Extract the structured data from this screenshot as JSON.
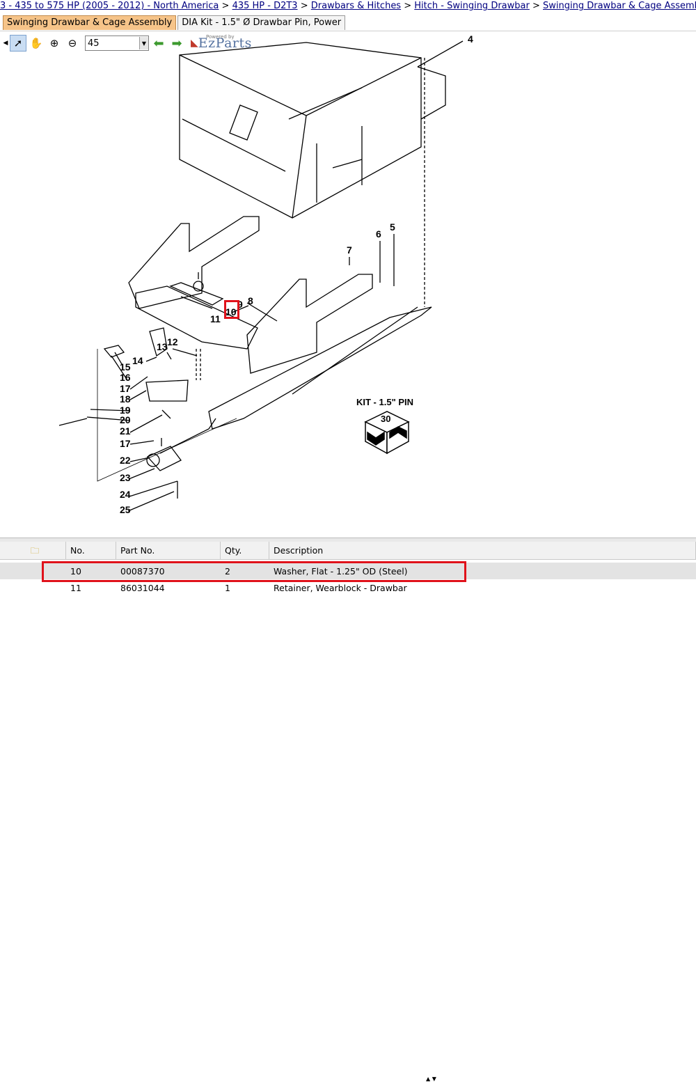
{
  "breadcrumb": [
    {
      "label": "3 - 435 to 575 HP (2005 - 2012) - North America"
    },
    {
      "label": "435 HP - D2T3"
    },
    {
      "label": "Drawbars & Hitches"
    },
    {
      "label": "Hitch - Swinging Drawbar"
    },
    {
      "label": "Swinging Drawbar & Cage Assembly"
    }
  ],
  "tabs": [
    {
      "label": "Swinging Drawbar & Cage Assembly"
    },
    {
      "label": "DIA Kit - 1.5\" Ø Drawbar Pin, Power"
    }
  ],
  "toolbar": {
    "zoom_value": "45",
    "brand_small": "Powered by",
    "brand_name": "EzParts"
  },
  "diagram": {
    "callouts": [
      "4",
      "5",
      "6",
      "7",
      "8",
      "9",
      "10",
      "11",
      "12",
      "13",
      "14",
      "15",
      "16",
      "17",
      "18",
      "19",
      "20",
      "21",
      "17",
      "22",
      "23",
      "24",
      "25"
    ],
    "kit_label": "KIT - 1.5\" PIN",
    "kit_number": "30"
  },
  "table": {
    "headers": [
      "",
      "No.",
      "Part No.",
      "Qty.",
      "Description"
    ],
    "rows": [
      {
        "no": "10",
        "part": "00087370",
        "qty": "2",
        "desc": "Washer, Flat - 1.25\" OD (Steel)"
      },
      {
        "no": "11",
        "part": "86031044",
        "qty": "1",
        "desc": "Retainer, Wearblock - Drawbar"
      }
    ]
  },
  "colors": {
    "active_tab": "#f6c489",
    "highlight_red": "#e0121b",
    "link_blue": "#000080"
  }
}
